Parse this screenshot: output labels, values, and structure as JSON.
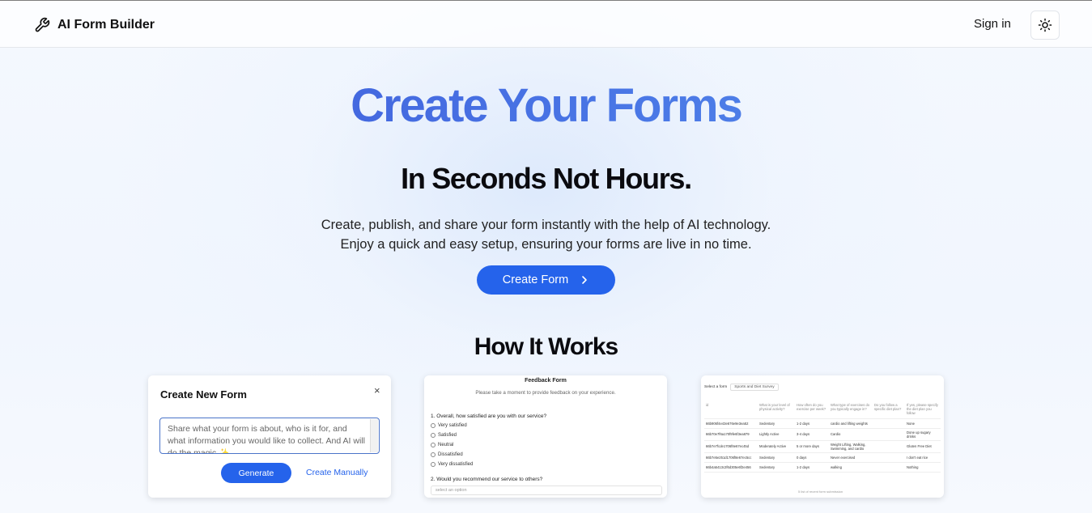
{
  "header": {
    "brand": "AI Form Builder",
    "brand_icon": "wrench-icon",
    "signin": "Sign in",
    "theme_icon": "sun-icon"
  },
  "hero": {
    "title": "Create Your Forms",
    "subtitle": "In Seconds Not Hours.",
    "desc_line1": "Create, publish, and share your form instantly with the help of AI technology.",
    "desc_line2": "Enjoy a quick and easy setup, ensuring your forms are live in no time.",
    "cta": "Create Form"
  },
  "how": {
    "title": "How It Works"
  },
  "card1": {
    "title": "Create New Form",
    "close": "×",
    "placeholder": "Share what your form is about, who is it for, and what information you would like to collect. And AI will do the magic ✨",
    "generate": "Generate",
    "manual": "Create Manually"
  },
  "card2": {
    "title": "Feedback Form",
    "desc": "Please take a moment to provide feedback on your experience.",
    "q1": "1. Overall, how satisfied are you with our service?",
    "options": [
      "Very satisfied",
      "Satisfied",
      "Neutral",
      "Dissatisfied",
      "Very dissatisfied"
    ],
    "q2": "2. Would you recommend our service to others?",
    "select": "select an option"
  },
  "card3": {
    "select_label": "Select a form",
    "selected_form": "Sports and Diet Survey",
    "headers": [
      "id",
      "What is your level of physical activity?",
      "How often do you exercise per week?",
      "What type of exercises do you typically engage in?",
      "Do you follow a specific diet plan?",
      "If yes, please specify the diet plan you follow"
    ],
    "rows": [
      [
        "66b906f4e43e676e9e3ea52",
        "Sedentary",
        "1-2 days",
        "cardio and lifting weights",
        "",
        "None"
      ],
      [
        "66b70e7f6a170f9fe6f3ea879",
        "Lightly Active",
        "3-4 days",
        "Cardio",
        "",
        "Done up sugary drinks"
      ],
      [
        "66b7e7fcde1706f8e67ec45d",
        "Moderately Active",
        "5 or more days",
        "Weight Lifting, Walking, Swimming, and cardio",
        "",
        "Gluten Free Diet"
      ],
      [
        "66b7e5e251d1706f8e67ec5cc",
        "Sedentary",
        "0 days",
        "Never exercised",
        "",
        "I don't eat rice"
      ],
      [
        "66b4a5413c2f6d305e6f2e456",
        "Sedentary",
        "1-2 days",
        "walking",
        "",
        "Nothing"
      ]
    ],
    "footer": "5 list of recent form submission"
  }
}
